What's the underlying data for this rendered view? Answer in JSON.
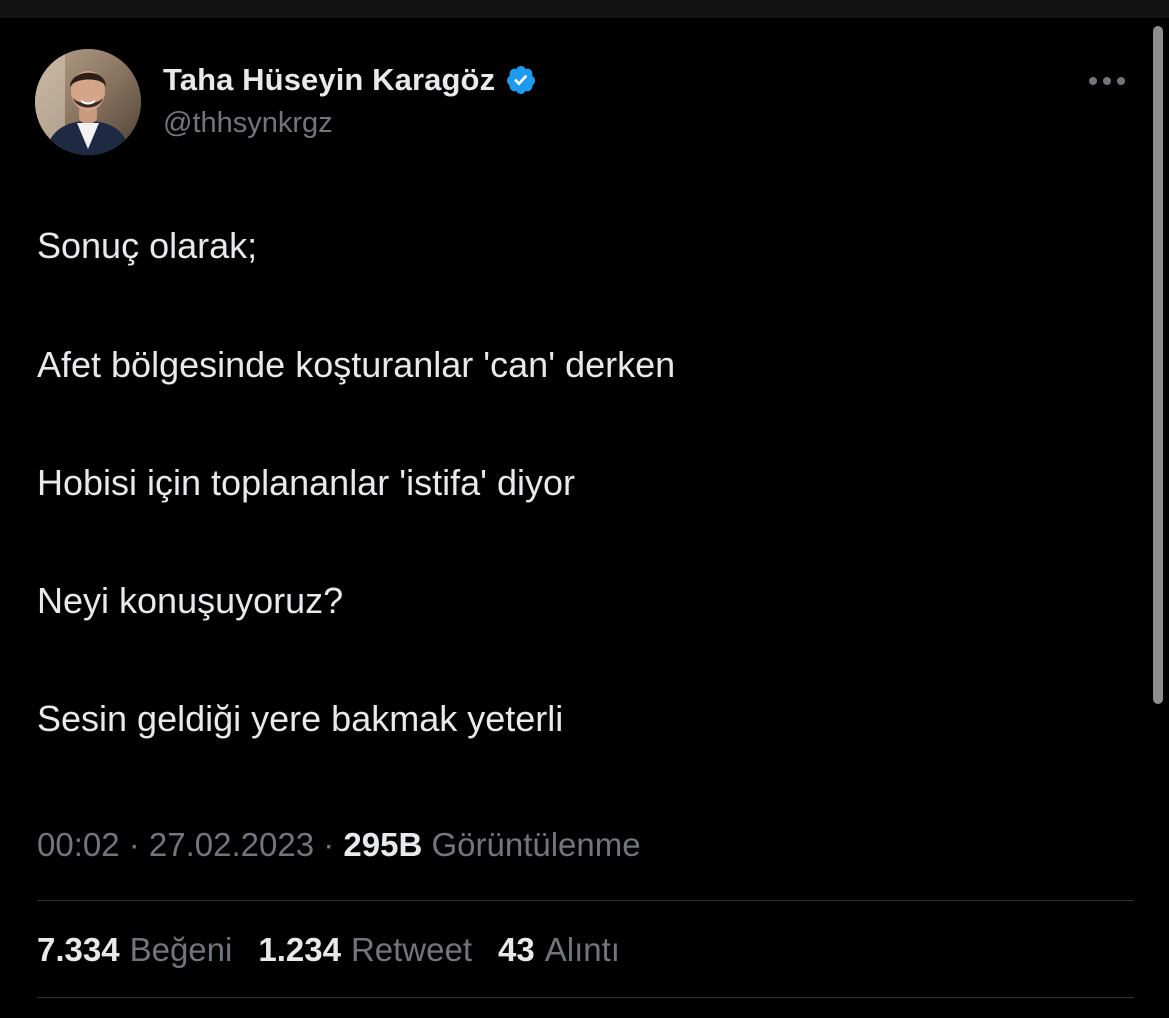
{
  "author": {
    "display_name": "Taha Hüseyin Karagöz",
    "handle": "@thhsynkrgz",
    "verified": true,
    "avatar_icon": "profile-photo",
    "verified_icon": "verified-badge-icon"
  },
  "tweet": {
    "lines": [
      "Sonuç olarak;",
      "Afet bölgesinde koşturanlar 'can' derken",
      "Hobisi için toplananlar 'istifa' diyor",
      "Neyi konuşuyoruz?",
      "Sesin geldiği yere bakmak yeterli"
    ]
  },
  "meta": {
    "time": "00:02",
    "separator": " · ",
    "date": "27.02.2023",
    "views_count": "295B",
    "views_label": "Görüntülenme"
  },
  "stats": [
    {
      "count": "7.334",
      "label": "Beğeni"
    },
    {
      "count": "1.234",
      "label": "Retweet"
    },
    {
      "count": "43",
      "label": "Alıntı"
    }
  ],
  "colors": {
    "background": "#000000",
    "primary_text": "#e7e9ea",
    "secondary_text": "#71767b",
    "verified_blue": "#1d9bf0",
    "divider": "#2f3336"
  }
}
